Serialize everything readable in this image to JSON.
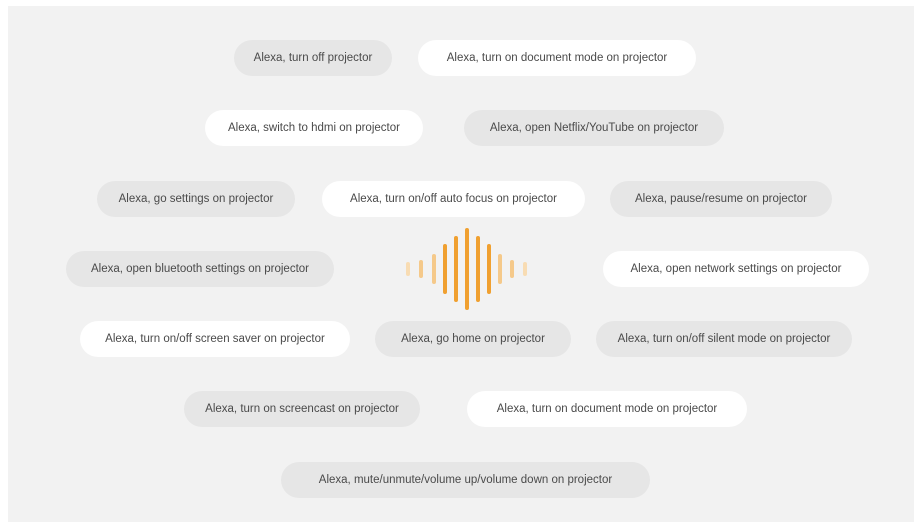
{
  "commands": [
    {
      "key": "turn-off-projector",
      "label": "Alexa, turn off projector",
      "style": "gray"
    },
    {
      "key": "document-mode-1",
      "label": "Alexa, turn on document mode on projector",
      "style": "white"
    },
    {
      "key": "switch-hdmi",
      "label": "Alexa, switch to hdmi on projector",
      "style": "white"
    },
    {
      "key": "open-netflix-youtube",
      "label": "Alexa, open Netflix/YouTube on projector",
      "style": "gray"
    },
    {
      "key": "go-settings",
      "label": "Alexa, go settings on projector",
      "style": "gray"
    },
    {
      "key": "auto-focus",
      "label": "Alexa, turn on/off auto focus on projector",
      "style": "white"
    },
    {
      "key": "pause-resume",
      "label": "Alexa, pause/resume on projector",
      "style": "gray"
    },
    {
      "key": "bluetooth-settings",
      "label": "Alexa, open bluetooth settings on projector",
      "style": "gray"
    },
    {
      "key": "network-settings",
      "label": "Alexa, open network settings on projector",
      "style": "white"
    },
    {
      "key": "screen-saver",
      "label": "Alexa, turn on/off screen saver on projector",
      "style": "white"
    },
    {
      "key": "go-home",
      "label": "Alexa, go home on projector",
      "style": "gray"
    },
    {
      "key": "silent-mode",
      "label": "Alexa, turn on/off silent mode on projector",
      "style": "gray"
    },
    {
      "key": "screencast",
      "label": "Alexa, turn on screencast on projector",
      "style": "gray"
    },
    {
      "key": "document-mode-2",
      "label": "Alexa, turn on document mode on projector",
      "style": "white"
    },
    {
      "key": "volume",
      "label": "Alexa, mute/unmute/volume up/volume down on projector",
      "style": "gray"
    }
  ],
  "voice_wave": {
    "icon": "voice-waveform-icon",
    "colors": {
      "strong": "#f0a030",
      "light": "#f5c98a",
      "faint": "#f8dcb3"
    }
  },
  "colors": {
    "background": "#f2f2f2",
    "pill_gray": "#e6e6e6",
    "pill_white": "#ffffff",
    "text": "#4a4a4a"
  }
}
